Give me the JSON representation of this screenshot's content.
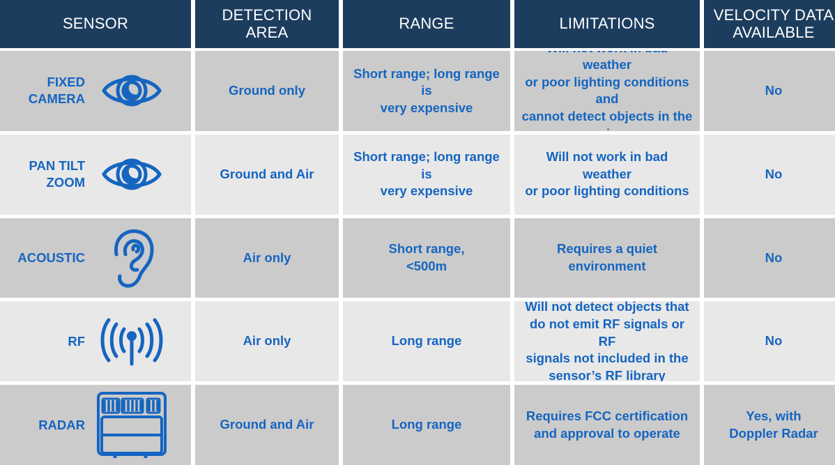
{
  "table": {
    "columns": [
      {
        "key": "sensor",
        "label": "SENSOR"
      },
      {
        "key": "detection",
        "label": "DETECTION AREA"
      },
      {
        "key": "range",
        "label": "RANGE"
      },
      {
        "key": "limits",
        "label": "LIMITATIONS"
      },
      {
        "key": "velocity",
        "label": "VELOCITY DATA\nAVAILABLE"
      }
    ],
    "rows": [
      {
        "sensor": "FIXED\nCAMERA",
        "icon": "eye-icon",
        "detection": "Ground only",
        "range": "Short range; long range is\nvery expensive",
        "limits": "Will not work in bad weather\nor poor lighting conditions and\ncannot detect objects in the air",
        "velocity": "No",
        "shade": "dark"
      },
      {
        "sensor": "PAN TILT\nZOOM",
        "icon": "eye-icon",
        "detection": "Ground and Air",
        "range": "Short range; long range is\nvery expensive",
        "limits": "Will not work in bad weather\nor poor lighting conditions",
        "velocity": "No",
        "shade": "light"
      },
      {
        "sensor": "ACOUSTIC",
        "icon": "ear-icon",
        "detection": "Air only",
        "range": "Short range,\n<500m",
        "limits": "Requires a quiet\nenvironment",
        "velocity": "No",
        "shade": "dark"
      },
      {
        "sensor": "RF",
        "icon": "rf-antenna-icon",
        "detection": "Air only",
        "range": "Long range",
        "limits": "Will not detect objects that\ndo not emit RF signals or RF\nsignals not included in the\nsensor’s RF library",
        "velocity": "No",
        "shade": "light"
      },
      {
        "sensor": "RADAR",
        "icon": "radar-unit-icon",
        "detection": "Ground and Air",
        "range": "Long range",
        "limits": "Requires FCC certification\nand approval to operate",
        "velocity": "Yes, with\nDoppler Radar",
        "shade": "dark"
      }
    ]
  },
  "colors": {
    "header_bg": "#1d3d5e",
    "header_text": "#ffffff",
    "cell_text": "#1565c0",
    "row_shade_dark": "#cbcbcb",
    "row_shade_light": "#e8e8e8",
    "gutter": "#ffffff"
  }
}
